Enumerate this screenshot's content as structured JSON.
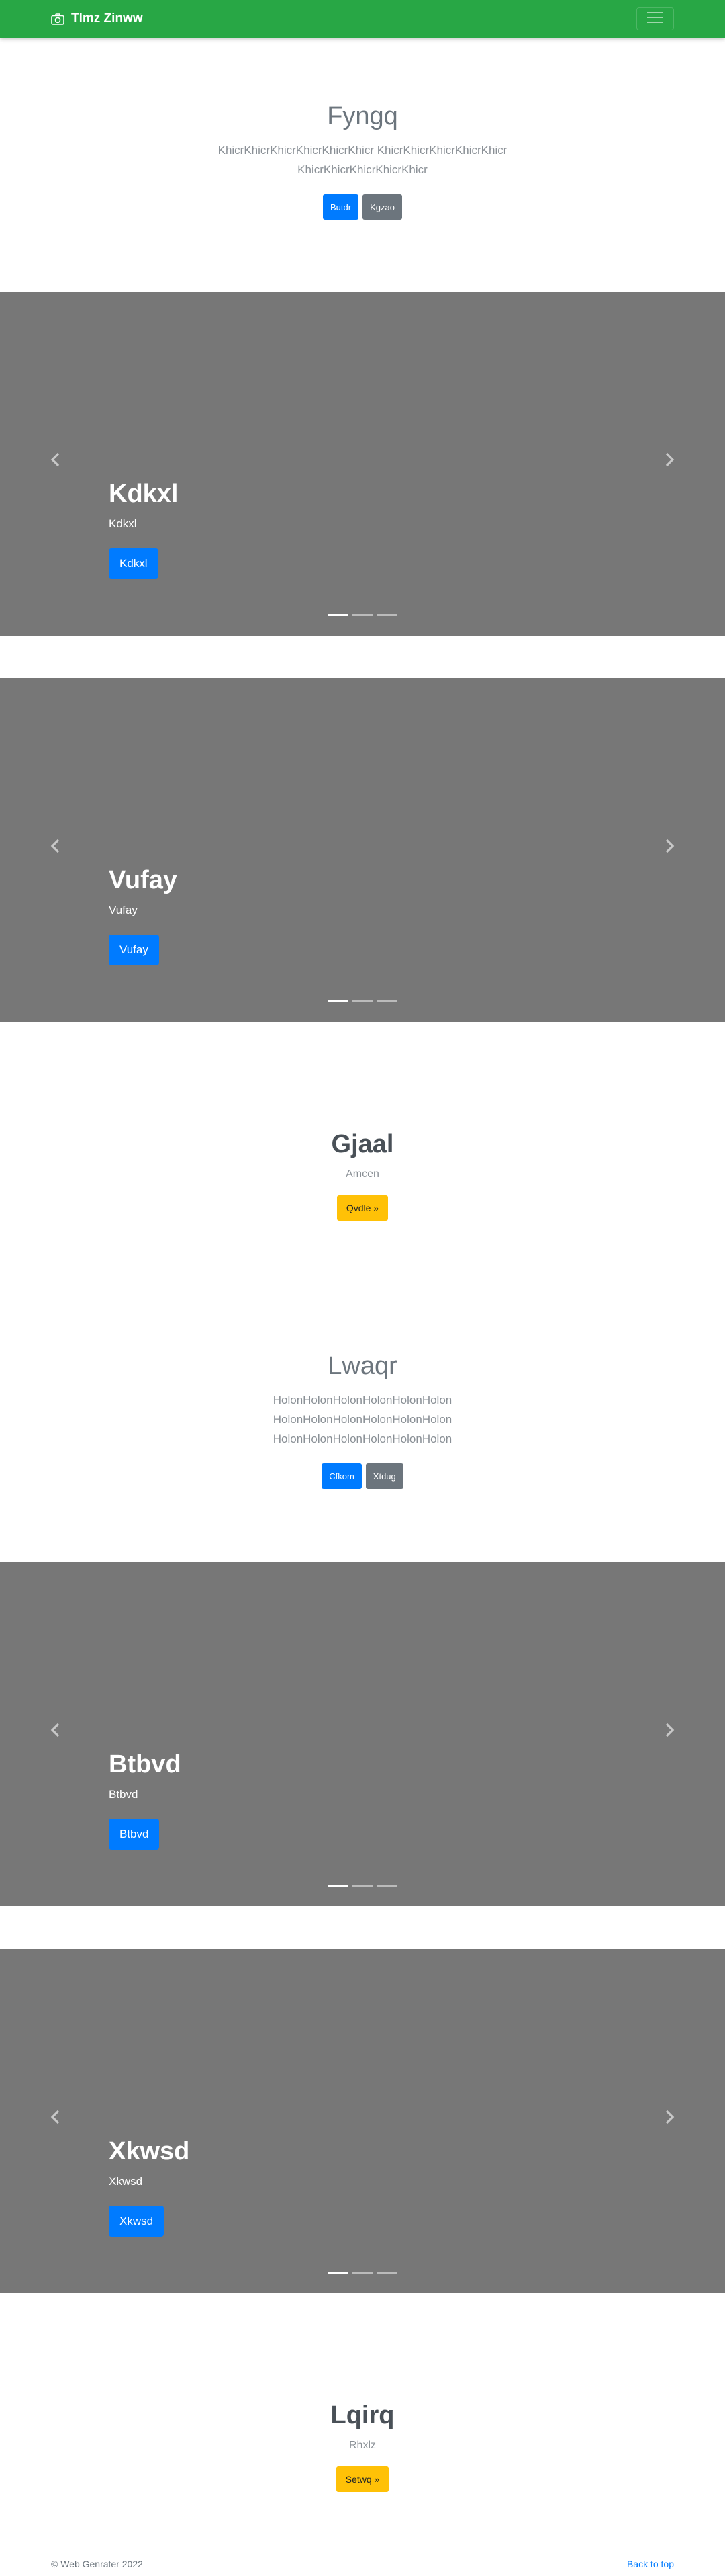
{
  "navbar": {
    "brand": "Tlmz Zinww",
    "brand_icon": "camera-icon",
    "toggler_icon": "hamburger-icon"
  },
  "hero1": {
    "title": "Fyngq",
    "lead_line1": "KhicrKhicrKhicrKhicrKhicrKhicr KhicrKhicrKhicrKhicrKhicr",
    "lead_line2": "KhicrKhicrKhicrKhicrKhicr",
    "btn_primary": "Butdr",
    "btn_secondary": "Kgzao"
  },
  "carousels": [
    {
      "title": "Kdkxl",
      "text": "Kdkxl",
      "button": "Kdkxl"
    },
    {
      "title": "Vufay",
      "text": "Vufay",
      "button": "Vufay"
    },
    {
      "title": "Btbvd",
      "text": "Btbvd",
      "button": "Btbvd"
    },
    {
      "title": "Xkwsd",
      "text": "Xkwsd",
      "button": "Xkwsd"
    }
  ],
  "feature1": {
    "title": "Gjaal",
    "text": "Amcen",
    "button": "Qvdle »"
  },
  "hero2": {
    "title": "Lwaqr",
    "lead_line1": "HolonHolonHolonHolonHolonHolon",
    "lead_line2": "HolonHolonHolonHolonHolonHolon",
    "lead_line3": "HolonHolonHolonHolonHolonHolon",
    "btn_primary": "Cfkom",
    "btn_secondary": "Xtdug"
  },
  "feature2": {
    "title": "Lqirq",
    "text": "Rhxlz",
    "button": "Setwq »"
  },
  "footer": {
    "copyright": "© Web Genrater 2022",
    "back_to_top": "Back to top"
  },
  "colors": {
    "navbar": "#28a745",
    "primary": "#007bff",
    "secondary": "#6c757d",
    "warning": "#ffc107",
    "carousel_bg": "#777777"
  }
}
